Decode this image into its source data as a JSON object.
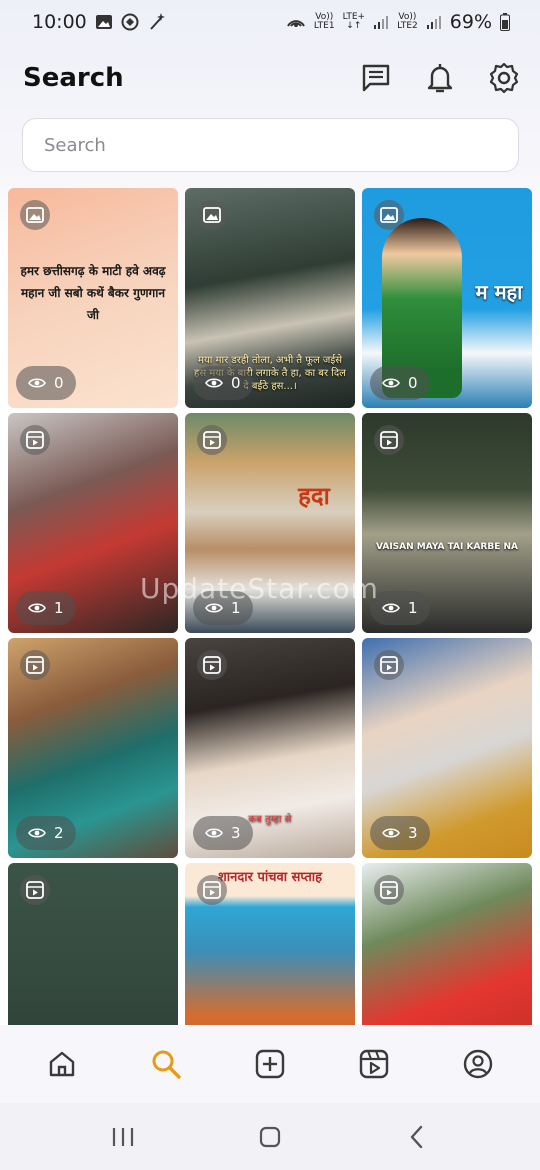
{
  "status_bar": {
    "time": "10:00",
    "battery": "69%",
    "sim1_top": "Vo))",
    "sim1_bottom": "LTE1",
    "lte_plus": "LTE+",
    "sim2_top": "Vo))",
    "sim2_bottom": "LTE2",
    "left_icons": [
      "image-icon",
      "chat-bubble-icon",
      "magic-wand-icon"
    ],
    "right_icons": [
      "hotspot-icon",
      "signal-icon",
      "signal-icon",
      "battery-icon"
    ]
  },
  "header": {
    "title": "Search",
    "icons": [
      "message-icon",
      "bell-icon",
      "gear-icon"
    ]
  },
  "search": {
    "placeholder": "Search"
  },
  "feed": {
    "watermark": "UpdateStar.com",
    "tiles": [
      {
        "type": "image",
        "views": "0",
        "caption": "हमर छत्तीसगढ़ के माटी हवे अवढ़ महान जी सबो कथें बैकर गुणगान जी"
      },
      {
        "type": "image",
        "views": "0",
        "caption": "मया मार डरही तोला, अभी तै फूल जईसे हस मया के बारी लगाके तै हा, का बर दिल दे बईठे हस...।"
      },
      {
        "type": "image",
        "views": "0",
        "caption": "म महा"
      },
      {
        "type": "video",
        "views": "1",
        "caption": ""
      },
      {
        "type": "video",
        "views": "1",
        "caption": "हदा"
      },
      {
        "type": "video",
        "views": "1",
        "caption": "VAISAN MAYA TAI KARBE NA"
      },
      {
        "type": "video",
        "views": "2",
        "caption": ""
      },
      {
        "type": "video",
        "views": "3",
        "caption": "कब तुम्हा से"
      },
      {
        "type": "video",
        "views": "3",
        "caption": ""
      },
      {
        "type": "video",
        "views": "",
        "caption": ""
      },
      {
        "type": "video",
        "views": "",
        "caption": "शानदार पांचवा सप्ताह"
      },
      {
        "type": "video",
        "views": "",
        "caption": ""
      }
    ]
  },
  "bottom_nav": {
    "items": [
      "home-icon",
      "search-icon",
      "add-icon",
      "reels-icon",
      "profile-icon"
    ],
    "active": "search-icon",
    "active_color": "#e89a16",
    "inactive_color": "#3a3a3a"
  },
  "system_nav": {
    "items": [
      "recent-apps-icon",
      "home-button-icon",
      "back-icon"
    ]
  }
}
